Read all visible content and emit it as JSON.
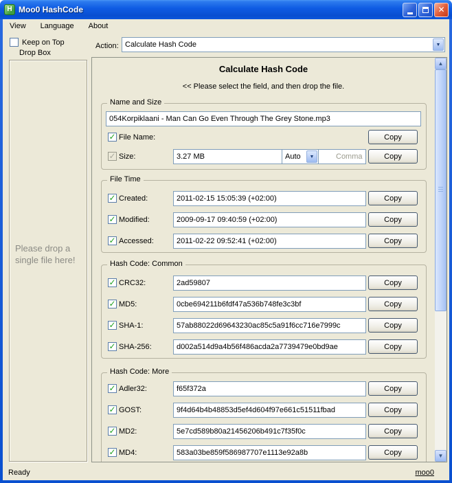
{
  "window": {
    "title": "Moo0 HashCode",
    "status_left": "Ready",
    "status_right": "moo0"
  },
  "menu": {
    "items": [
      "View",
      "Language",
      "About"
    ]
  },
  "sidebar": {
    "keep_on_top_label": "Keep on Top",
    "drop_box_label": "Drop Box",
    "drop_hint": "Please drop a single file here!"
  },
  "action": {
    "label": "Action:",
    "value": "Calculate Hash Code"
  },
  "panel": {
    "title": "Calculate Hash Code",
    "subtitle": "<< Please select the field, and then drop the file.",
    "copy_label": "Copy",
    "name_size": {
      "legend": "Name and Size",
      "file_name_value": "054Korpiklaani - Man Can Go Even Through The Grey Stone.mp3",
      "file_name_label": "File Name:",
      "size_label": "Size:",
      "size_value": "3.27 MB",
      "size_unit": "Auto",
      "comma_label": "Comma"
    },
    "file_time": {
      "legend": "File Time",
      "rows": [
        {
          "label": "Created:",
          "value": "2011-02-15 15:05:39 (+02:00)"
        },
        {
          "label": "Modified:",
          "value": "2009-09-17 09:40:59 (+02:00)"
        },
        {
          "label": "Accessed:",
          "value": "2011-02-22 09:52:41 (+02:00)"
        }
      ]
    },
    "hash_common": {
      "legend": "Hash Code: Common",
      "rows": [
        {
          "label": "CRC32:",
          "value": "2ad59807"
        },
        {
          "label": "MD5:",
          "value": "0cbe694211b6fdf47a536b748fe3c3bf"
        },
        {
          "label": "SHA-1:",
          "value": "57ab88022d69643230ac85c5a91f6cc716e7999c"
        },
        {
          "label": "SHA-256:",
          "value": "d002a514d9a4b56f486acda2a7739479e0bd9ae"
        }
      ]
    },
    "hash_more": {
      "legend": "Hash Code: More",
      "rows": [
        {
          "label": "Adler32:",
          "value": "f65f372a"
        },
        {
          "label": "GOST:",
          "value": "9f4d64b4b48853d5ef4d604f97e661c51511fbad"
        },
        {
          "label": "MD2:",
          "value": "5e7cd589b80a21456206b491c7f35f0c"
        },
        {
          "label": "MD4:",
          "value": "583a03be859f586987707e1113e92a8b"
        }
      ]
    }
  },
  "colors": {
    "titlebar_blue": "#0f5ce4",
    "window_frame": "#0a50d0",
    "window_bg": "#ece9d8",
    "close_red": "#d5502e",
    "check_green": "#21a121",
    "field_border": "#7f9db9"
  }
}
